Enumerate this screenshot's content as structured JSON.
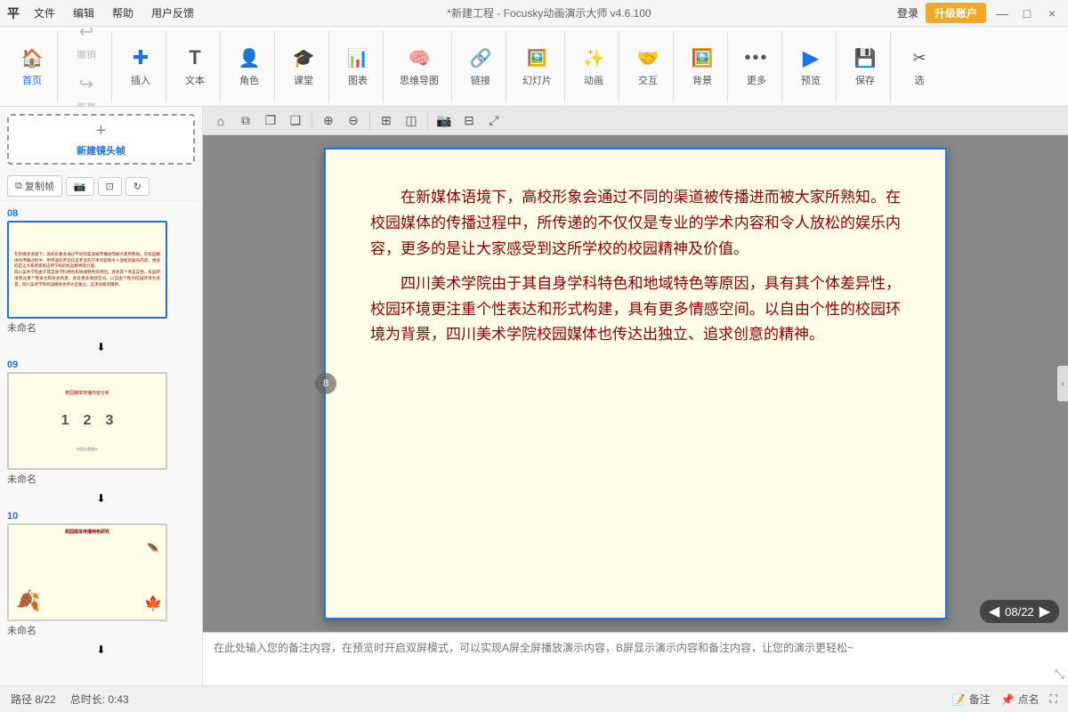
{
  "titleBar": {
    "logo": "平",
    "menu": [
      "文件",
      "编辑",
      "帮助",
      "用户反馈"
    ],
    "title": "*新建工程 - Focusky动画演示大师 v4.6.100",
    "loginLabel": "登录",
    "upgradeLabel": "升级账户",
    "winControls": [
      "—",
      "□",
      "×"
    ]
  },
  "toolbar": {
    "groups": [
      {
        "items": [
          {
            "icon": "🏠",
            "label": "首页",
            "active": true
          },
          {
            "icon": "↩",
            "label": "撤销",
            "disabled": true
          },
          {
            "icon": "↪",
            "label": "恢复",
            "disabled": true
          }
        ]
      },
      {
        "items": [
          {
            "icon": "✚",
            "label": "插入"
          }
        ]
      },
      {
        "items": [
          {
            "icon": "T",
            "label": "文本",
            "iconStyle": "text"
          }
        ]
      },
      {
        "items": [
          {
            "icon": "👤",
            "label": "角色"
          }
        ]
      },
      {
        "items": [
          {
            "icon": "🎓",
            "label": "课堂"
          }
        ]
      },
      {
        "items": [
          {
            "icon": "📊",
            "label": "图表"
          }
        ]
      },
      {
        "items": [
          {
            "icon": "🧠",
            "label": "思维导图"
          }
        ]
      },
      {
        "items": [
          {
            "icon": "🔗",
            "label": "链接"
          }
        ]
      },
      {
        "items": [
          {
            "icon": "🖼",
            "label": "幻灯片"
          }
        ]
      },
      {
        "items": [
          {
            "icon": "✨",
            "label": "动画"
          }
        ]
      },
      {
        "items": [
          {
            "icon": "🤝",
            "label": "交互"
          }
        ]
      },
      {
        "items": [
          {
            "icon": "🖼",
            "label": "背景"
          }
        ]
      },
      {
        "items": [
          {
            "icon": "⋯",
            "label": "更多"
          }
        ]
      },
      {
        "items": [
          {
            "icon": "▶",
            "label": "预览"
          }
        ]
      },
      {
        "items": [
          {
            "icon": "💾",
            "label": "保存"
          }
        ]
      },
      {
        "items": [
          {
            "icon": "✂",
            "label": "选"
          }
        ]
      }
    ]
  },
  "slides": [
    {
      "num": "08",
      "name": "未命名",
      "selected": true,
      "content": "slide08"
    },
    {
      "num": "09",
      "name": "未命名",
      "selected": false,
      "content": "slide09"
    },
    {
      "num": "10",
      "name": "未命名",
      "selected": false,
      "content": "slide10"
    }
  ],
  "addFrame": {
    "plusIcon": "+",
    "label": "新建镜头帧"
  },
  "frameTools": {
    "copyLabel": "复制帧",
    "screenshotLabel": "📷",
    "fitLabel": "⊡",
    "rotateLabel": "↻"
  },
  "slideContent": {
    "paragraph1": "在新媒体语境下，高校形象会通过不同的渠道被传播进而被大家所熟知。在校园媒体的传播过程中，所传递的不仅仅是专业的学术内容和令人放松的娱乐内容，更多的是让大家感受到这所学校的校园精神及价值。",
    "paragraph2": "四川美术学院由于其自身学科特色和地域特色等原因，具有其个体差异性，校园环境更注重个性表达和形式构建，具有更多情感空间。以自由个性的校园环境为背景，四川美术学院校园媒体也传达出独立、追求创意的精神。"
  },
  "canvasTools": {
    "homeIcon": "⌂",
    "copyIcon": "⧉",
    "copyIcon2": "❐",
    "copyIcon3": "❑",
    "zoomInIcon": "⊕",
    "zoomOutIcon": "⊖",
    "tableIcon": "⊞",
    "lockIcon": "◫",
    "cameraIcon": "📷",
    "gridIcon": "⊟",
    "expandIcon": "⤢"
  },
  "badge": {
    "prevIcon": "◀",
    "nextIcon": "▶",
    "pageInfo": "08/22"
  },
  "notesPlaceholder": "在此处输入您的备注内容，在预览时开启双屏模式，可以实现A屏全屏播放演示内容，B屏显示演示内容和备注内容，让您的演示更轻松~",
  "statusBar": {
    "path": "路径 8/22",
    "duration": "总时长: 0:43",
    "annotateLabel": "备注",
    "pointLabel": "点名"
  },
  "colors": {
    "accent": "#1a73e8",
    "upgrade": "#f5a623",
    "textColor": "#8b0000",
    "bgColor": "#fffde7"
  }
}
